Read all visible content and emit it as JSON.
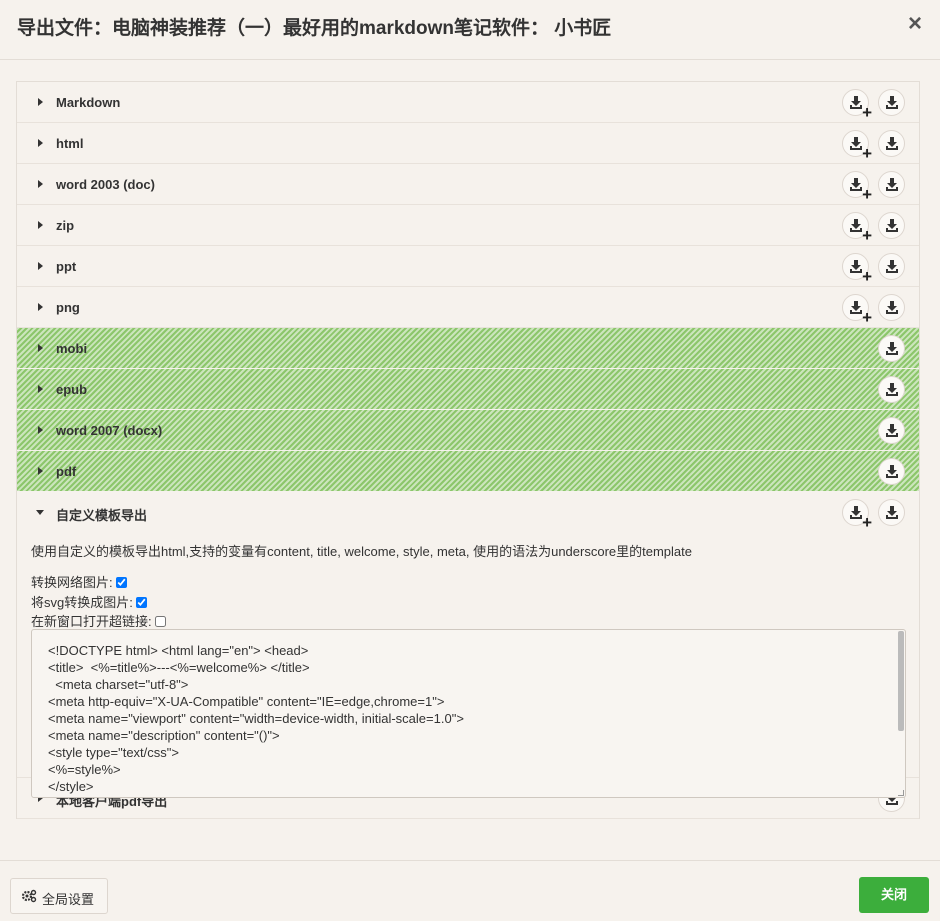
{
  "dialog": {
    "title": "导出文件：电脑神装推荐（一）最好用的markdown笔记软件： 小书匠",
    "close_symbol": "×"
  },
  "formats": [
    {
      "label": "Markdown",
      "striped": false,
      "add_button": true
    },
    {
      "label": "html",
      "striped": false,
      "add_button": true
    },
    {
      "label": "word 2003 (doc)",
      "striped": false,
      "add_button": true
    },
    {
      "label": "zip",
      "striped": false,
      "add_button": true
    },
    {
      "label": "ppt",
      "striped": false,
      "add_button": true
    },
    {
      "label": "png",
      "striped": false,
      "add_button": true
    },
    {
      "label": "mobi",
      "striped": true,
      "add_button": false
    },
    {
      "label": "epub",
      "striped": true,
      "add_button": false
    },
    {
      "label": "word 2007 (docx)",
      "striped": true,
      "add_button": false
    },
    {
      "label": "pdf",
      "striped": true,
      "add_button": false
    }
  ],
  "icons": {
    "add": "download-add-icon",
    "download": "download-icon",
    "plus": "+",
    "settings": "gear-icon"
  },
  "colors": {
    "stripe_green": "#8cc66b",
    "close_button": "#3cae3c",
    "background": "#f6f2ed"
  },
  "custom_template": {
    "label": "自定义模板导出",
    "description": "使用自定义的模板导出html,支持的变量有content, title, welcome, style, meta, 使用的语法为underscore里的template",
    "options": [
      {
        "label": "转换网络图片:",
        "checked": true
      },
      {
        "label": "将svg转换成图片:",
        "checked": true
      },
      {
        "label": "在新窗口打开超链接:",
        "checked": false
      }
    ],
    "template_code": "<!DOCTYPE html> <html lang=\"en\"> <head>\n<title>  <%=title%>---<%=welcome%> </title>\n  <meta charset=\"utf-8\">\n<meta http-equiv=\"X-UA-Compatible\" content=\"IE=edge,chrome=1\">\n<meta name=\"viewport\" content=\"width=device-width, initial-scale=1.0\">\n<meta name=\"description\" content=\"()\">\n<style type=\"text/css\">\n<%=style%>\n</style>"
  },
  "local_pdf": {
    "label": "本地客户端pdf导出"
  },
  "footer": {
    "settings_label": "全局设置",
    "close_label": "关闭"
  }
}
